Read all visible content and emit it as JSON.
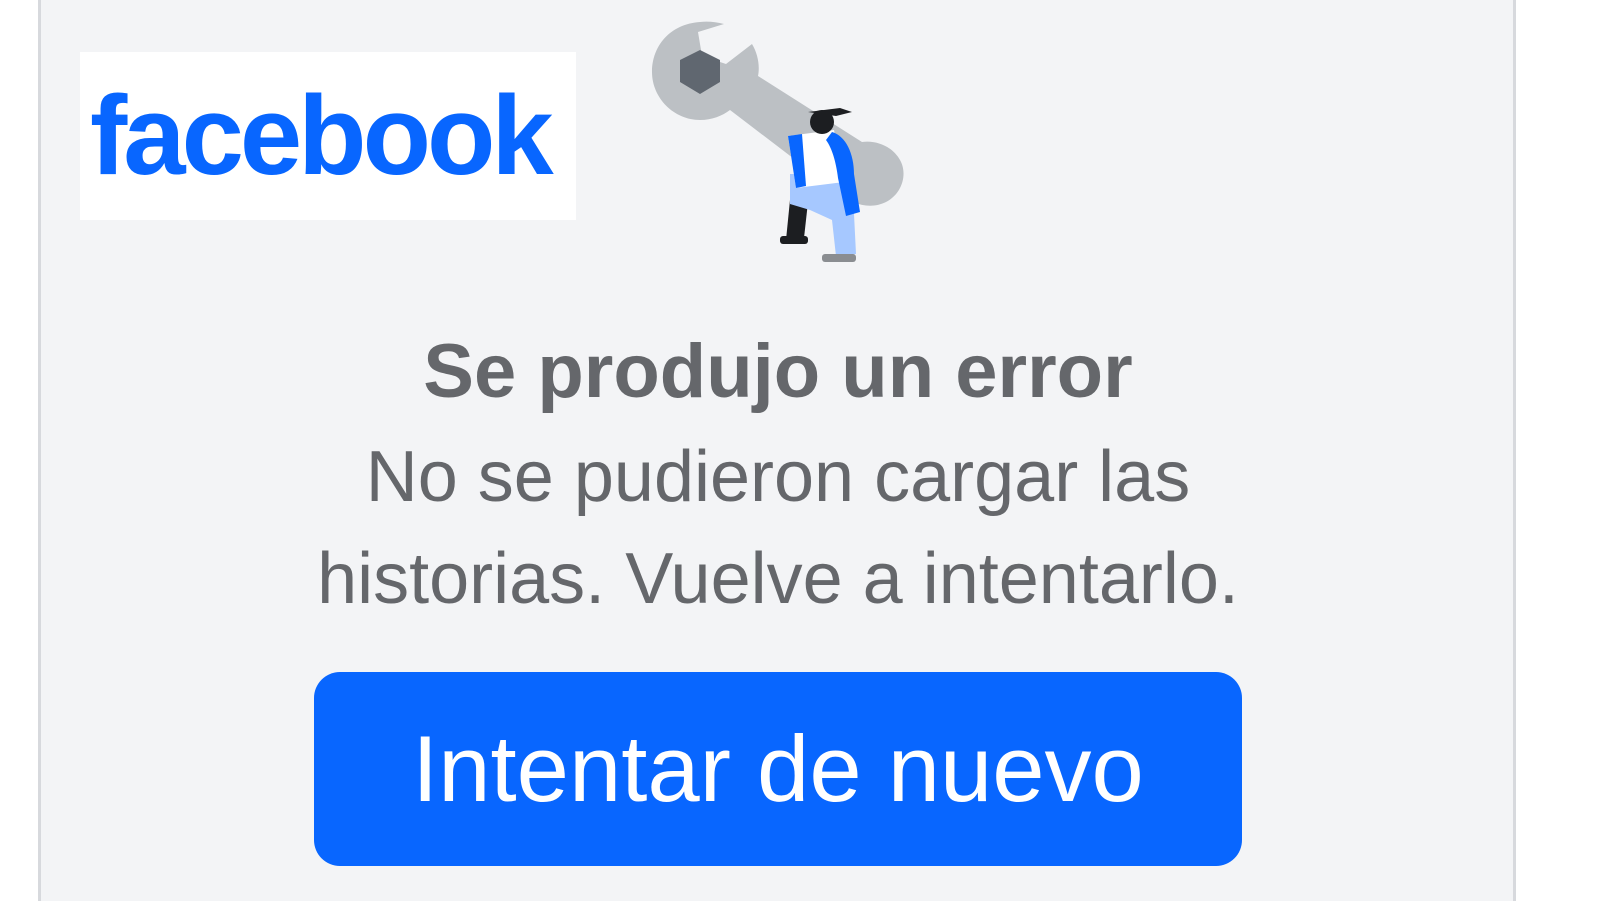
{
  "brand": {
    "logo_text": "facebook",
    "color": "#0866ff"
  },
  "illustration": {
    "icon": "wrench-worker-illustration"
  },
  "error": {
    "title": "Se produjo un error",
    "line1": "No se pudieron cargar las",
    "line2": "historias. Vuelve a intentarlo."
  },
  "actions": {
    "retry_label": "Intentar de nuevo"
  },
  "colors": {
    "accent": "#0866ff",
    "text_secondary": "#65676b",
    "background": "#f3f4f6"
  }
}
